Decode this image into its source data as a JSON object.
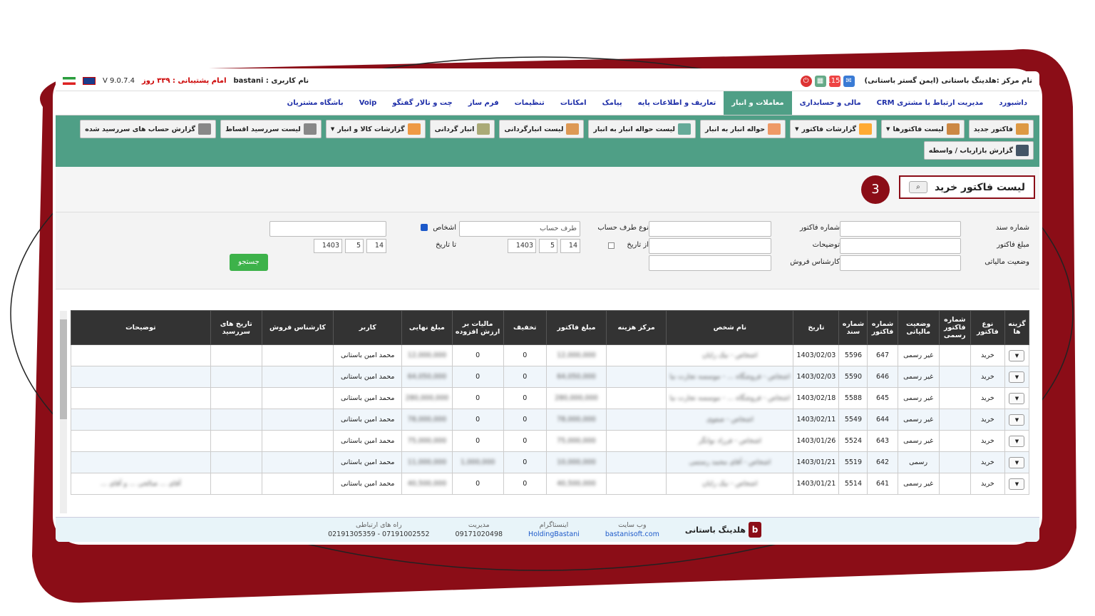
{
  "topbar": {
    "center_name": "نام مرکز :هلدینگ باستانی (ایمن گستر باستانی)",
    "badge": "115",
    "user": "نام کاربری : bastani",
    "support": "امام پشتیبانی : ۳۳۹ روز",
    "version": "V 9.0.7.4"
  },
  "menu": [
    "داشبورد",
    "مدیریت ارتباط با مشتری CRM",
    "مالی و حسابداری",
    "معاملات و انبار",
    "تعاریف و اطلاعات پایه",
    "پیامک",
    "امکانات",
    "تنظیمات",
    "فرم ساز",
    "چت و تالار گفتگو",
    "Voip",
    "باشگاه مشتریان"
  ],
  "toolbar": [
    "فاکتور جدید",
    "لیست فاکتورها",
    "گزارشات فاکتور",
    "حواله انبار به انبار",
    "لیست حواله انبار به انبار",
    "لیست انبارگردانی",
    "انبار گردانی",
    "گزارشات کالا و انبار",
    "لیست سررسید اقساط",
    "گزارش حساب های سررسید شده",
    "گزارش بازاریاب / واسطه"
  ],
  "page_title": "لیست فاکتور خرید",
  "step": "3",
  "filters": {
    "doc_no": "شماره سند",
    "invoice_no": "شماره فاکتور",
    "account_type": "نوع طرف حساب",
    "account_placeholder": "طرف حساب",
    "persons": "اشخاص",
    "amount": "مبلغ فاکتور",
    "desc": "توضیحات",
    "from_date": "از تاریخ",
    "to_date": "تا تاریخ",
    "tax_status": "وضعیت مالیاتی",
    "sales_expert": "کارشناس فروش",
    "day": "14",
    "month": "5",
    "year": "1403",
    "search": "جستجو"
  },
  "table": {
    "headers": [
      "گزینه ها",
      "نوع فاکتور",
      "شماره فاکتور رسمی",
      "وضعیت مالیاتی",
      "شماره فاکتور",
      "شماره سند",
      "تاریخ",
      "نام شخص",
      "مرکز هزینه",
      "مبلغ فاکتور",
      "تخفیف",
      "مالیات بر ارزش افزوده",
      "مبلغ نهایی",
      "کاربر",
      "کارشناس فروش",
      "تاریخ های سررسید",
      "توضیحات"
    ],
    "rows": [
      {
        "type": "خرید",
        "tax": "غیر رسمی",
        "inv": "647",
        "doc": "5596",
        "date": "1403/02/03",
        "person": "اشخاص - نیک رایان",
        "amount": "12,000,000",
        "disc": "0",
        "vat": "0",
        "final": "12,000,000",
        "user": "محمد امین باستانی",
        "desc": ""
      },
      {
        "type": "خرید",
        "tax": "غیر رسمی",
        "inv": "646",
        "doc": "5590",
        "date": "1403/02/03",
        "person": "اشخاص - فروشگاه ... - موسسه تجارت نیا",
        "amount": "64,050,000",
        "disc": "0",
        "vat": "0",
        "final": "64,050,000",
        "user": "محمد امین باستانی",
        "desc": ""
      },
      {
        "type": "خرید",
        "tax": "غیر رسمی",
        "inv": "645",
        "doc": "5588",
        "date": "1403/02/18",
        "person": "اشخاص - فروشگاه ... - موسسه تجارت نیا",
        "amount": "280,000,000",
        "disc": "0",
        "vat": "0",
        "final": "280,000,000",
        "user": "محمد امین باستانی",
        "desc": ""
      },
      {
        "type": "خرید",
        "tax": "غیر رسمی",
        "inv": "644",
        "doc": "5549",
        "date": "1403/02/11",
        "person": "اشخاص - صفوی",
        "amount": "78,000,000",
        "disc": "0",
        "vat": "0",
        "final": "78,000,000",
        "user": "محمد امین باستانی",
        "desc": ""
      },
      {
        "type": "خرید",
        "tax": "غیر رسمی",
        "inv": "643",
        "doc": "5524",
        "date": "1403/01/26",
        "person": "اشخاص - فرزاد نوانگر",
        "amount": "75,000,000",
        "disc": "0",
        "vat": "0",
        "final": "75,000,000",
        "user": "محمد امین باستانی",
        "desc": ""
      },
      {
        "type": "خرید",
        "tax": "رسمی",
        "inv": "642",
        "doc": "5519",
        "date": "1403/01/21",
        "person": "اشخاص - آقای محمد رستمی",
        "amount": "10,000,000",
        "disc": "0",
        "vat": "1,000,000",
        "final": "11,000,000",
        "user": "محمد امین باستانی",
        "desc": ""
      },
      {
        "type": "خرید",
        "tax": "غیر رسمی",
        "inv": "641",
        "doc": "5514",
        "date": "1403/01/21",
        "person": "اشخاص - نیک رایان",
        "amount": "40,500,000",
        "disc": "0",
        "vat": "0",
        "final": "40,500,000",
        "user": "محمد امین باستانی",
        "desc": "آقای ... صالحی ... و آقای ..."
      }
    ]
  },
  "footer": {
    "brand": "هلدینگ باستانی",
    "website_h": "وب سایت",
    "website": "bastanisoft.com",
    "insta_h": "اینستاگرام",
    "insta": "HoldingBastani",
    "mgmt_h": "مدیریت",
    "mgmt": "09171020498",
    "contact_h": "راه های ارتباطی",
    "contact": "07191002552 - 02191305359"
  },
  "colors": {
    "accent": "#4f9f86",
    "frame": "#8b0d17",
    "menu_text": "#1f2fa8"
  }
}
